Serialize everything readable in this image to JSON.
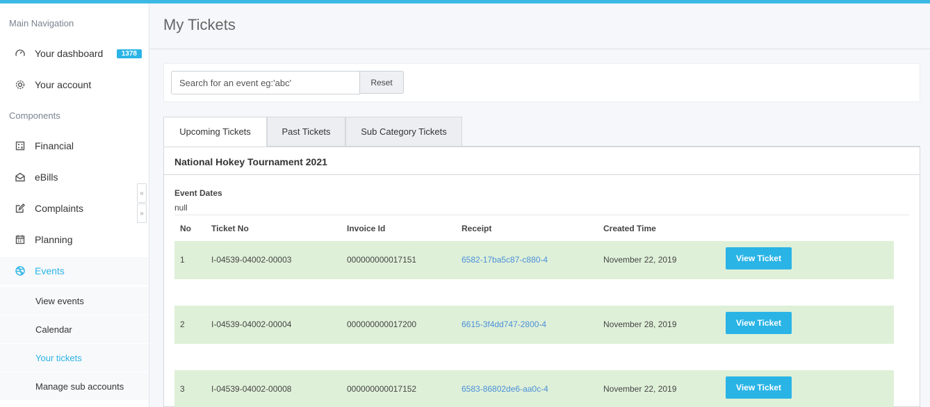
{
  "sidebar": {
    "main_nav_label": "Main Navigation",
    "components_label": "Components",
    "dashboard": {
      "label": "Your dashboard",
      "badge": "1378"
    },
    "account": {
      "label": "Your account"
    },
    "items": [
      {
        "label": "Financial",
        "icon": "calculator-icon"
      },
      {
        "label": "eBills",
        "icon": "envelope-icon"
      },
      {
        "label": "Complaints",
        "icon": "edit-icon"
      },
      {
        "label": "Planning",
        "icon": "calendar-icon"
      },
      {
        "label": "Events",
        "icon": "dribbble-icon"
      }
    ],
    "events_sub": [
      {
        "label": "View events"
      },
      {
        "label": "Calendar"
      },
      {
        "label": "Your tickets"
      },
      {
        "label": "Manage sub accounts"
      }
    ],
    "scroll_up": "«",
    "scroll_down": "»"
  },
  "header": {
    "title": "My Tickets"
  },
  "search": {
    "placeholder": "Search for an event eg:'abc'",
    "reset_label": "Reset"
  },
  "tabs": [
    {
      "label": "Upcoming Tickets"
    },
    {
      "label": "Past Tickets"
    },
    {
      "label": "Sub Category Tickets"
    }
  ],
  "event": {
    "title": "National Hokey Tournament 2021",
    "dates_label": "Event Dates",
    "dates_value": "null"
  },
  "table": {
    "columns": [
      "No",
      "Ticket No",
      "Invoice Id",
      "Receipt",
      "Created Time"
    ],
    "view_label": "View Ticket",
    "rows": [
      {
        "no": "1",
        "ticket": "I-04539-04002-00003",
        "invoice": "000000000017151",
        "receipt": "6582-17ba5c87-c880-4",
        "created": "November 22, 2019"
      },
      {
        "no": "2",
        "ticket": "I-04539-04002-00004",
        "invoice": "000000000017200",
        "receipt": "6615-3f4dd747-2800-4",
        "created": "November 28, 2019"
      },
      {
        "no": "3",
        "ticket": "I-04539-04002-00008",
        "invoice": "000000000017152",
        "receipt": "6583-86802de6-aa0c-4",
        "created": "November 22, 2019"
      }
    ]
  },
  "colors": {
    "accent": "#2ab4e6",
    "row_bg": "#dff0d8",
    "link": "#4a8fd8"
  }
}
